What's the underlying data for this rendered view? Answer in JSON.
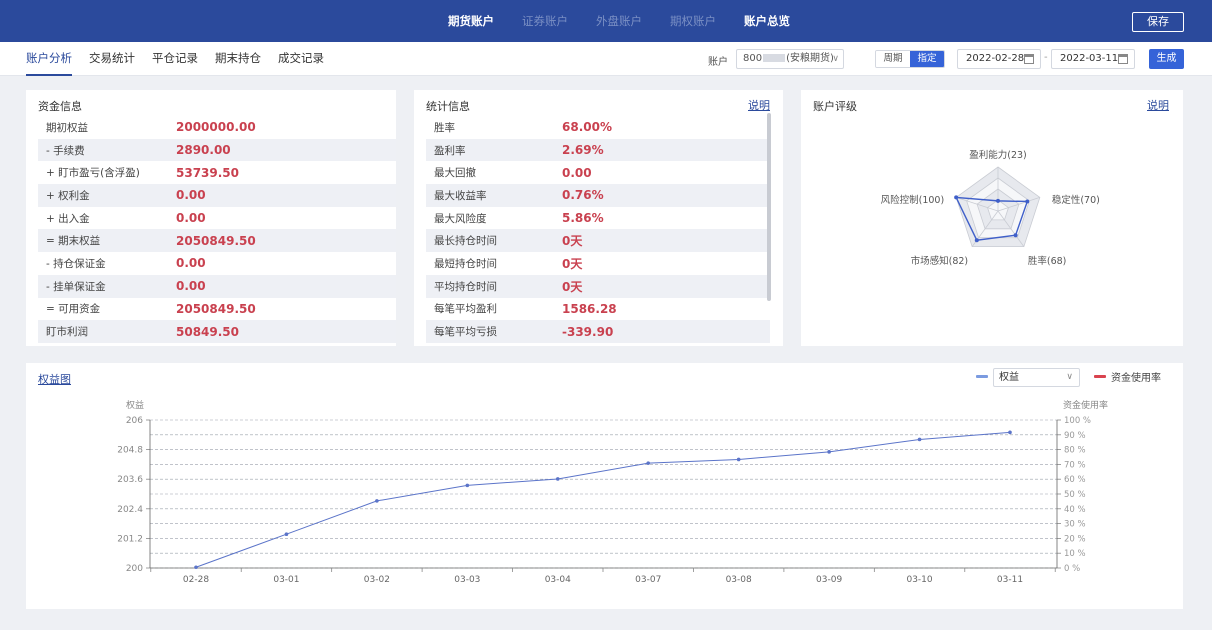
{
  "topnav": {
    "items": [
      {
        "label": "期货账户",
        "active": true
      },
      {
        "label": "证券账户",
        "active": false
      },
      {
        "label": "外盘账户",
        "active": false
      },
      {
        "label": "期权账户",
        "active": false
      },
      {
        "label": "账户总览",
        "active": true
      }
    ],
    "save_label": "保存"
  },
  "subnav": {
    "tabs": [
      {
        "label": "账户分析",
        "active": true
      },
      {
        "label": "交易统计",
        "active": false
      },
      {
        "label": "平仓记录",
        "active": false
      },
      {
        "label": "期末持仓",
        "active": false
      },
      {
        "label": "成交记录",
        "active": false
      }
    ],
    "account_label": "账户",
    "account_prefix": "800",
    "account_suffix": "(安粮期货)",
    "period_options": [
      {
        "label": "周期",
        "active": false
      },
      {
        "label": "指定",
        "active": true
      }
    ],
    "date_start": "2022-02-28",
    "date_separator": "-",
    "date_end": "2022-03-11",
    "generate_label": "生成"
  },
  "fund_info": {
    "title": "资金信息",
    "rows": [
      {
        "label": "期初权益",
        "value": "2000000.00"
      },
      {
        "label": "- 手续费",
        "value": "2890.00"
      },
      {
        "label": "+ 盯市盈亏(含浮盈)",
        "value": "53739.50"
      },
      {
        "label": "+ 权利金",
        "value": "0.00"
      },
      {
        "label": "+ 出入金",
        "value": "0.00"
      },
      {
        "label": "= 期末权益",
        "value": "2050849.50"
      },
      {
        "label": "- 持仓保证金",
        "value": "0.00"
      },
      {
        "label": "- 挂单保证金",
        "value": "0.00"
      },
      {
        "label": "= 可用资金",
        "value": "2050849.50"
      },
      {
        "label": "盯市利润",
        "value": "50849.50"
      }
    ]
  },
  "stats_info": {
    "title": "统计信息",
    "link": "说明",
    "rows": [
      {
        "label": "胜率",
        "value": "68.00%"
      },
      {
        "label": "盈利率",
        "value": "2.69%"
      },
      {
        "label": "最大回撤",
        "value": "0.00"
      },
      {
        "label": "最大收益率",
        "value": "0.76%"
      },
      {
        "label": "最大风险度",
        "value": "5.86%"
      },
      {
        "label": "最长持仓时间",
        "value": "0天"
      },
      {
        "label": "最短持仓时间",
        "value": "0天"
      },
      {
        "label": "平均持仓时间",
        "value": "0天"
      },
      {
        "label": "每笔平均盈利",
        "value": "1586.28"
      },
      {
        "label": "每笔平均亏损",
        "value": "-339.90"
      }
    ]
  },
  "rating": {
    "title": "账户评级",
    "link": "说明",
    "axes": [
      {
        "label": "盈利能力(23)",
        "value": 23
      },
      {
        "label": "稳定性(70)",
        "value": 70
      },
      {
        "label": "胜率(68)",
        "value": 68
      },
      {
        "label": "市场感知(82)",
        "value": 82
      },
      {
        "label": "风险控制(100)",
        "value": 100
      }
    ],
    "max": 100
  },
  "equity_chart": {
    "title": "权益图",
    "series_select": "权益",
    "legend": [
      {
        "label": "权益",
        "color": "#7b9be0"
      },
      {
        "label": "资金使用率",
        "color": "#d9434f"
      }
    ],
    "line_color": "#5b74c9"
  },
  "chart_data": {
    "type": "line",
    "x": [
      "02-28",
      "03-01",
      "03-02",
      "03-03",
      "03-04",
      "03-07",
      "03-08",
      "03-09",
      "03-10",
      "03-11"
    ],
    "series": [
      {
        "name": "权益",
        "values": [
          200.03,
          201.37,
          202.72,
          203.35,
          203.61,
          204.25,
          204.4,
          204.71,
          205.21,
          205.5
        ]
      }
    ],
    "ylabel": "权益",
    "ylabel_right": "资金使用率",
    "ylim": [
      200,
      206
    ],
    "yticks": [
      "200",
      "201.2",
      "202.4",
      "203.6",
      "204.8",
      "206"
    ],
    "ytick_values": [
      200,
      201.2,
      202.4,
      203.6,
      204.8,
      206
    ],
    "y2lim": [
      0,
      100
    ],
    "y2ticks": [
      "0 %",
      "10 %",
      "20 %",
      "30 %",
      "40 %",
      "50 %",
      "60 %",
      "70 %",
      "80 %",
      "90 %",
      "100 %"
    ],
    "grid": true
  }
}
